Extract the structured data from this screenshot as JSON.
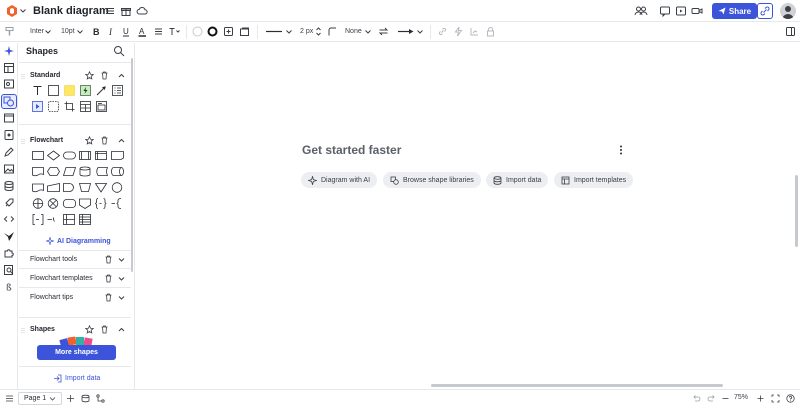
{
  "header": {
    "title": "Blank diagram",
    "share_label": "Share"
  },
  "format": {
    "font": "Inter",
    "font_size": "10pt",
    "line_width": "2 px",
    "arrow_start": "None"
  },
  "panel": {
    "title": "Shapes",
    "sections": [
      {
        "title": "Standard"
      },
      {
        "title": "Flowchart"
      }
    ],
    "ai_label": "AI Diagramming",
    "rows": [
      {
        "label": "Flowchart tools"
      },
      {
        "label": "Flowchart templates"
      },
      {
        "label": "Flowchart tips"
      }
    ],
    "shapes_section": "Shapes",
    "more_shapes": "More shapes",
    "import_data": "Import data"
  },
  "canvas": {
    "title": "Get started faster",
    "actions": [
      {
        "label": "Diagram with AI"
      },
      {
        "label": "Browse shape libraries"
      },
      {
        "label": "Import data"
      },
      {
        "label": "Import templates"
      }
    ]
  },
  "footer": {
    "page_label": "Page 1",
    "zoom": "75%"
  },
  "colors": {
    "accent": "#3c54d9",
    "text": "#282c33",
    "border": "#e6e8eb"
  }
}
